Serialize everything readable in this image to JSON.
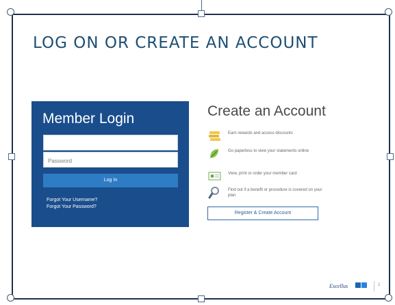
{
  "slide": {
    "title": "LOG ON OR CREATE AN ACCOUNT"
  },
  "login": {
    "heading": "Member Login",
    "username_value": "",
    "password_placeholder": "Password",
    "login_label": "Log In",
    "forgot_username": "Forgot Your Username?",
    "forgot_password": "Forgot Your Password?"
  },
  "create_account": {
    "heading": "Create an Account",
    "benefits": [
      {
        "icon": "coins-icon",
        "text": "Earn rewards and access discounts"
      },
      {
        "icon": "paperless-leaf-icon",
        "text": "Go paperless to view your statements online"
      },
      {
        "icon": "member-card-icon",
        "text": "View, print or order your member card"
      },
      {
        "icon": "magnifier-icon",
        "text": "Find out if a benefit or procedure is covered on your plan"
      }
    ],
    "register_label": "Register & Create Account"
  },
  "footer": {
    "logo_text": "Excellus",
    "page_number": "2"
  },
  "colors": {
    "login_panel": "#1a4d8c",
    "login_button": "#2e7cc4",
    "title": "#1d4e73",
    "frame": "#1f2f4f"
  }
}
